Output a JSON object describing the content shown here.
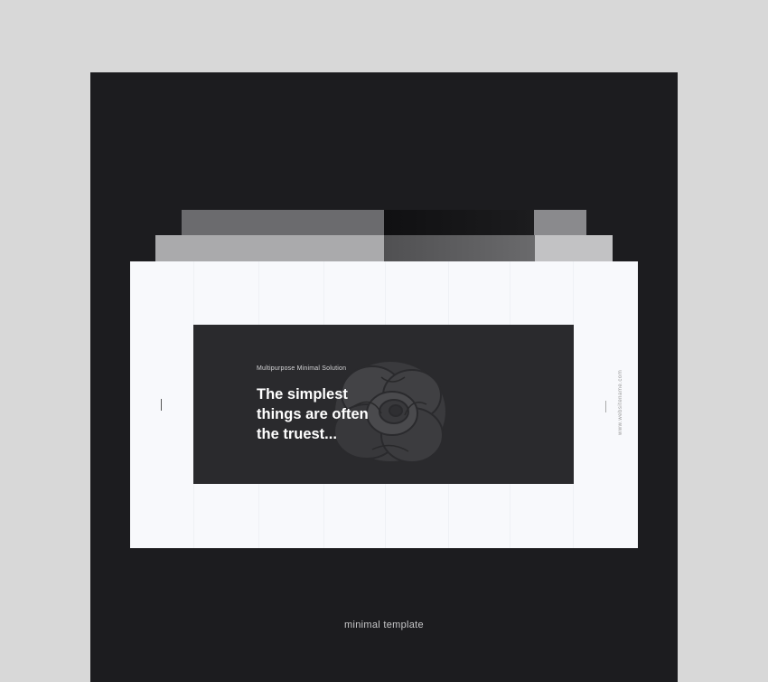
{
  "slide": {
    "eyebrow": "Multipurpose Minimal Solution",
    "headline": "The simplest\nthings are often\nthe truest...",
    "side_url": "www.websitename.com"
  },
  "caption": "minimal template",
  "colors": {
    "background": "#d8d8d8",
    "cover": "#1c1c1f",
    "slide": "#f8f9fc",
    "hero": "#2a2a2d",
    "headline": "#ffffff"
  },
  "icons": {
    "hero_image": "rose-flower-image"
  }
}
